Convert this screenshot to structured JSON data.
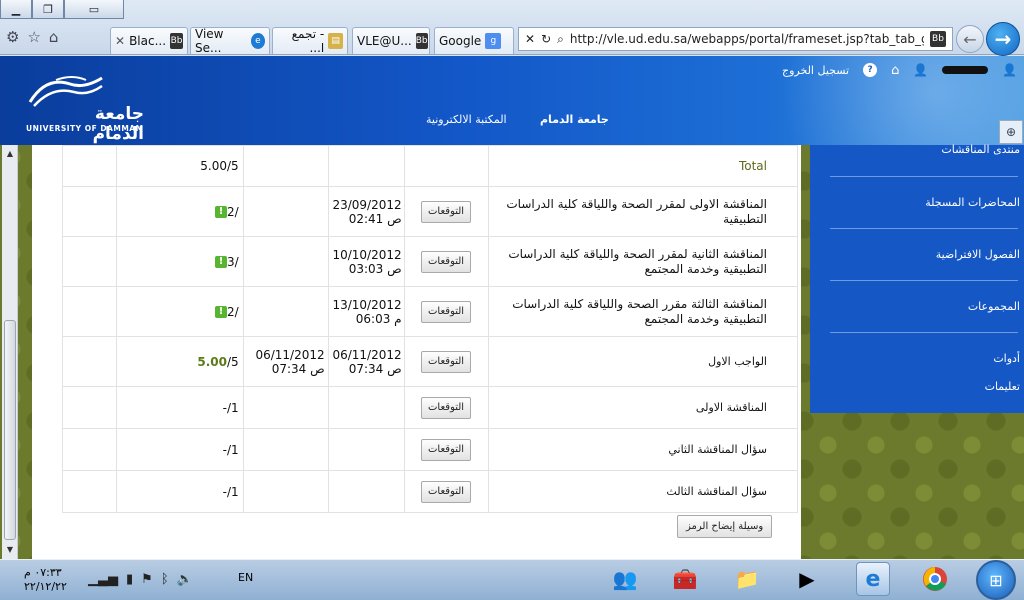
{
  "window": {
    "minimize_icon": "minimize-icon",
    "restore_icon": "restore-icon",
    "close_icon": "close-icon"
  },
  "browser": {
    "tabs": [
      {
        "label": "Blac...",
        "icon": "blackboard-icon"
      },
      {
        "label": "View Se...",
        "icon": "ie-icon"
      },
      {
        "label": "- تجمع ا...",
        "icon": "document-icon"
      },
      {
        "label": "VLE@U...",
        "icon": "blackboard-icon"
      },
      {
        "label": "Google",
        "icon": "google-icon"
      }
    ],
    "address_url": "http://vle.ud.edu.sa/webapps/portal/frameset.jsp?tab_tab_group",
    "address_host": "ud.edu.sa"
  },
  "site": {
    "logo_arabic": "جامعة الدمام",
    "logo_english": "UNIVERSITY OF DAMMAM",
    "logout": "تسجيل الخروج",
    "help": "?",
    "nav": [
      "جامعة الدمام",
      "المكتبة الالكترونية"
    ]
  },
  "grades": {
    "total_label": "Total",
    "total_score": "5.00/5",
    "rows": [
      {
        "name": "المناقشة الاولى لمقرر الصحة واللياقة كلية الدراسات التطبيقية",
        "date1_date": "23/09/2012",
        "date1_time": "02:41 ص",
        "date2_date": "",
        "date2_time": "",
        "score": "2/",
        "flag": "!",
        "button": "التوقعات"
      },
      {
        "name": "المناقشة الثانية لمقرر الصحة واللياقة كلية الدراسات التطبيقية وخدمة المجتمع",
        "date1_date": "10/10/2012",
        "date1_time": "03:03 ص",
        "date2_date": "",
        "date2_time": "",
        "score": "3/",
        "flag": "!",
        "button": "التوقعات"
      },
      {
        "name": "المناقشة الثالثة مقرر الصحة واللياقة كلية الدراسات التطبيقية وخدمة المجتمع",
        "date1_date": "13/10/2012",
        "date1_time": "06:03 م",
        "date2_date": "",
        "date2_time": "",
        "score": "2/",
        "flag": "!",
        "button": "التوقعات"
      },
      {
        "name": "الواجب الاول",
        "date1_date": "06/11/2012",
        "date1_time": "07:34 ص",
        "date2_date": "06/11/2012",
        "date2_time": "07:34 ص",
        "score_bold": "5.00",
        "score_rest": "/5",
        "button": "التوقعات"
      },
      {
        "name": "المناقشة الاولى",
        "score": "-/1",
        "button": "التوقعات"
      },
      {
        "name": "سؤال المناقشة الثاني",
        "score": "-/1",
        "button": "التوقعات"
      },
      {
        "name": "سؤال المناقشة الثالث",
        "score": "-/1",
        "button": "التوقعات"
      }
    ],
    "key_button": "وسيلة إيضاح الرمز"
  },
  "sidebar": {
    "items": [
      "منتدى المناقشات",
      "المحاضرات المسجلة",
      "الفصول الافتراضية",
      "المجموعات",
      "أدوات",
      "تعليمات"
    ]
  },
  "taskbar": {
    "clock_time": "٠٧:٣٣ م",
    "clock_date": "٢٢/١٢/٢٢",
    "language": "EN"
  },
  "colors": {
    "header_blue": "#1357c8",
    "sidebar_blue": "#1557c4",
    "link_olive": "#5d6b1a",
    "flag_green": "#58b531"
  }
}
